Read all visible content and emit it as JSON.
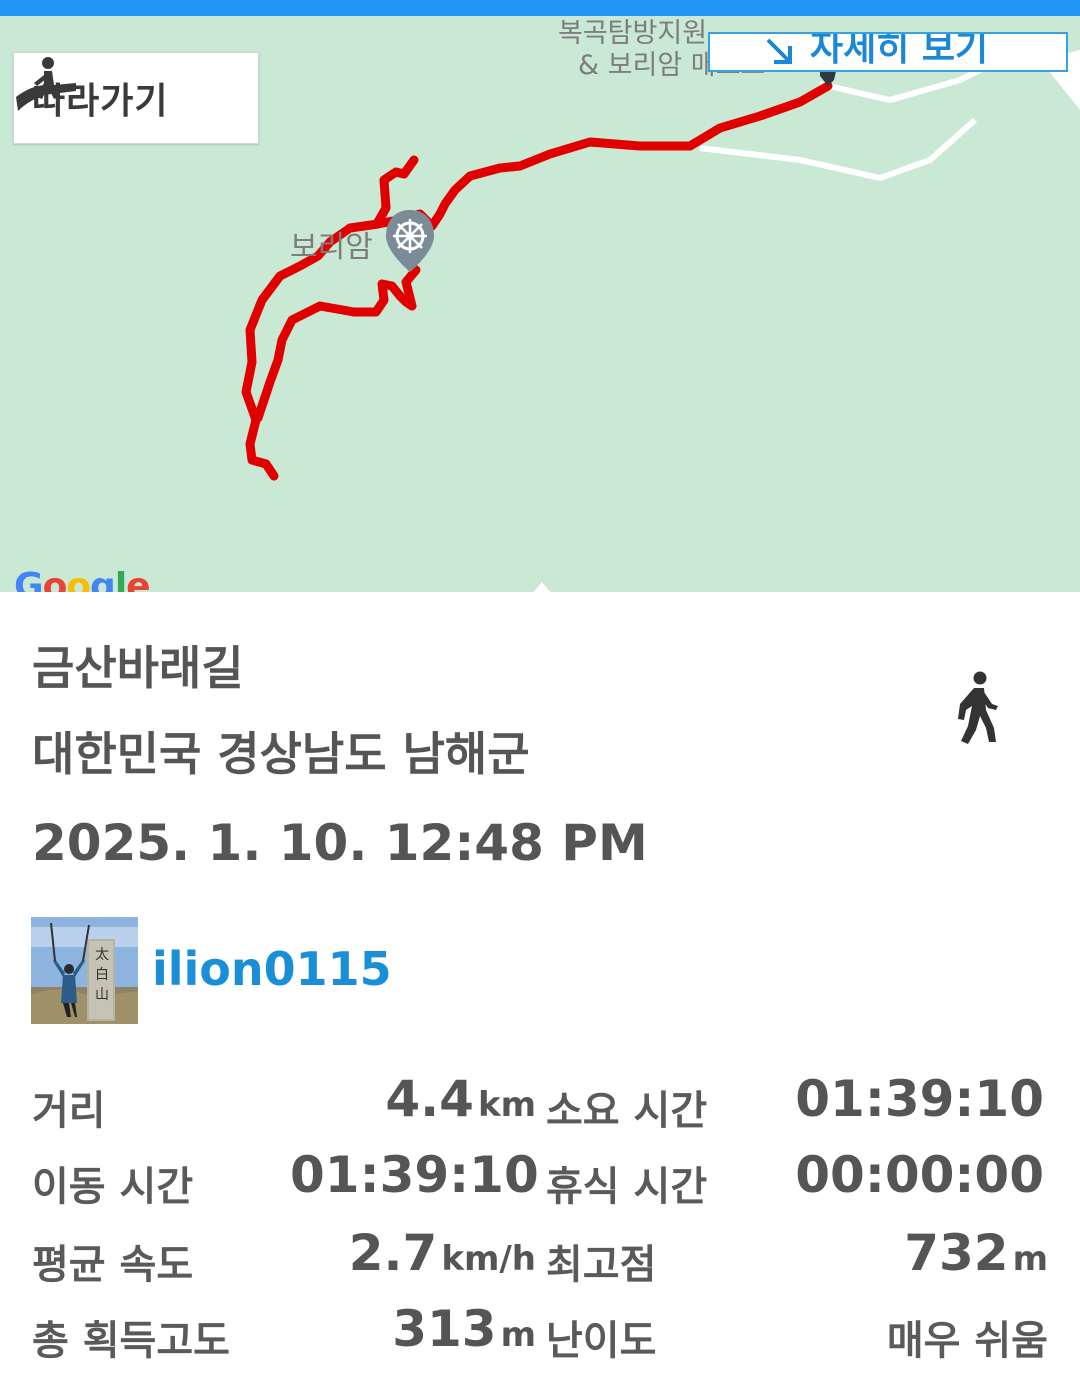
{
  "map": {
    "follow_label": "따라가기",
    "detail_label": "자세히 보기",
    "poi_top_line1": "복곡탐방지원",
    "poi_top_line2": "& 보리암 매표소",
    "poi_temple": "보리암",
    "google_letters": [
      "G",
      "o",
      "o",
      "g",
      "l",
      "e"
    ],
    "google_colors": [
      "#4285f4",
      "#ea4335",
      "#fbbc05",
      "#4285f4",
      "#34a853",
      "#ea4335"
    ],
    "track_color": "#e00000",
    "background_color": "#c9e9d4"
  },
  "trail": {
    "name": "금산바래길",
    "location": "대한민국 경상남도 남해군",
    "datetime": "2025. 1. 10. 12:48 PM",
    "activity_icon": "walking-person-icon",
    "user": "ilion0115"
  },
  "stats": {
    "distance_label": "거리",
    "distance_value": "4.4",
    "distance_unit": "km",
    "total_time_label": "소요 시간",
    "total_time_value": "01:39:10",
    "moving_time_label": "이동 시간",
    "moving_time_value": "01:39:10",
    "rest_time_label": "휴식 시간",
    "rest_time_value": "00:00:00",
    "avg_speed_label": "평균 속도",
    "avg_speed_value": "2.7",
    "avg_speed_unit": "km/h",
    "max_elev_label": "최고점",
    "max_elev_value": "732",
    "max_elev_unit": "m",
    "total_gain_label": "총 획득고도",
    "total_gain_value": "313",
    "total_gain_unit": "m",
    "difficulty_label": "난이도",
    "difficulty_value": "매우 쉬움"
  }
}
